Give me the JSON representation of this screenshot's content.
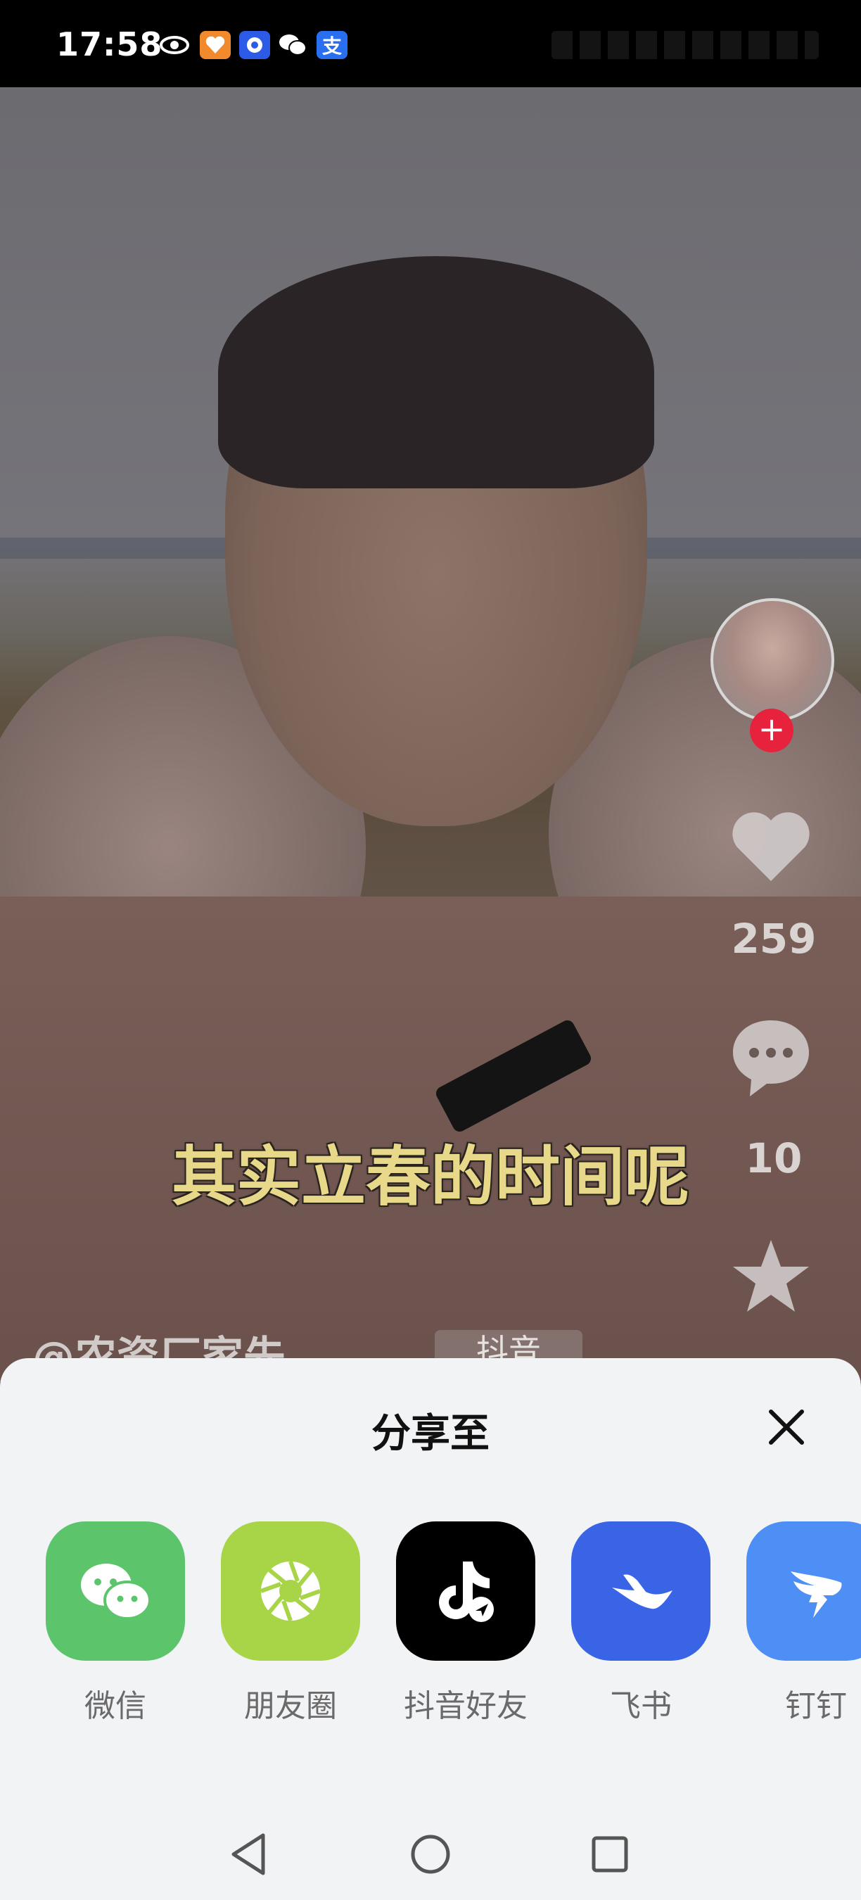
{
  "status_bar": {
    "time": "17:58",
    "app_icons": [
      "eye-icon",
      "heart-app-icon",
      "circle-app-icon",
      "wechat-icon",
      "alipay-icon"
    ],
    "alipay_glyph": "支"
  },
  "video": {
    "subtitle": "其实立春的时间呢",
    "author": "@农资厂家先",
    "tag": "抖音",
    "likes": "259",
    "comments": "10",
    "follow_glyph": "+"
  },
  "share_sheet": {
    "title": "分享至",
    "items": [
      {
        "label": "微信",
        "icon": "wechat-icon",
        "color": "#5cc56c"
      },
      {
        "label": "朋友圈",
        "icon": "moments-icon",
        "color": "#a8d548"
      },
      {
        "label": "抖音好友",
        "icon": "douyin-icon",
        "color": "#000000"
      },
      {
        "label": "飞书",
        "icon": "feishu-icon",
        "color": "#3a64e6"
      },
      {
        "label": "钉钉",
        "icon": "dingtalk-icon",
        "color": "#4d8ff5"
      }
    ]
  },
  "nav_bar": {
    "buttons": [
      "back-icon",
      "home-icon",
      "recents-icon"
    ]
  }
}
